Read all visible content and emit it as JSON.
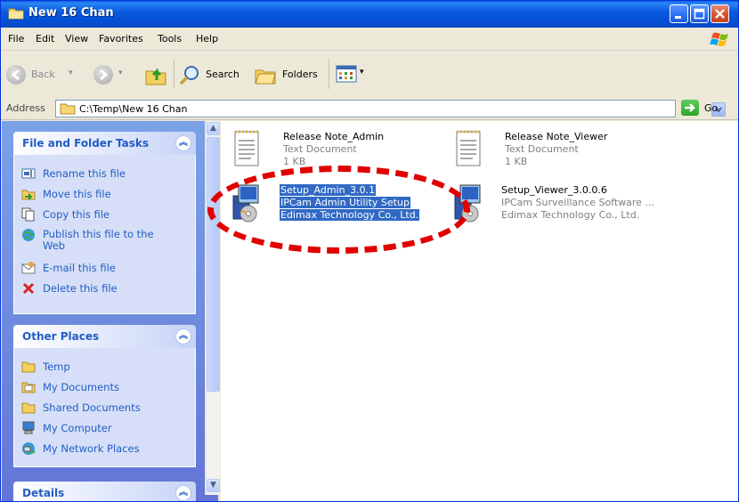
{
  "window": {
    "title": "New 16 Chan"
  },
  "menu": [
    "File",
    "Edit",
    "View",
    "Favorites",
    "Tools",
    "Help"
  ],
  "toolbar": {
    "back": "Back",
    "search": "Search",
    "folders": "Folders"
  },
  "address": {
    "label": "Address",
    "value": "C:\\Temp\\New 16 Chan",
    "go": "Go"
  },
  "tasks_panel": {
    "title": "File and Folder Tasks",
    "items": [
      {
        "label": "Rename this file",
        "icon": "rename-icon"
      },
      {
        "label": "Move this file",
        "icon": "move-icon"
      },
      {
        "label": "Copy this file",
        "icon": "copy-icon"
      },
      {
        "label": "Publish this file to the Web",
        "icon": "publish-icon"
      },
      {
        "label": "E-mail this file",
        "icon": "email-icon"
      },
      {
        "label": "Delete this file",
        "icon": "delete-icon"
      }
    ]
  },
  "places_panel": {
    "title": "Other Places",
    "items": [
      {
        "label": "Temp",
        "icon": "folder-icon"
      },
      {
        "label": "My Documents",
        "icon": "my-documents-icon"
      },
      {
        "label": "Shared Documents",
        "icon": "folder-icon"
      },
      {
        "label": "My Computer",
        "icon": "my-computer-icon"
      },
      {
        "label": "My Network Places",
        "icon": "network-icon"
      }
    ]
  },
  "details_panel": {
    "title": "Details"
  },
  "files": [
    {
      "name": "Release Note_Admin",
      "desc": "Text Document",
      "size": "1 KB",
      "icon": "text-document-icon",
      "selected": false
    },
    {
      "name": "Release Note_Viewer",
      "desc": "Text Document",
      "size": "1 KB",
      "icon": "text-document-icon",
      "selected": false
    },
    {
      "name": "Setup_Admin_3.0.1",
      "desc": "IPCam Admin Utility Setup",
      "size": "Edimax Technology Co., Ltd.",
      "icon": "setup-installer-icon",
      "selected": true
    },
    {
      "name": "Setup_Viewer_3.0.0.6",
      "desc": "IPCam Surveillance Software ...",
      "size": "Edimax Technology Co., Ltd.",
      "icon": "setup-installer-icon",
      "selected": false
    }
  ],
  "colors": {
    "titlebar": "#0a5fe8",
    "selection": "#316ac5",
    "annotation_oval": "#e10000",
    "task_link": "#215dc6"
  }
}
